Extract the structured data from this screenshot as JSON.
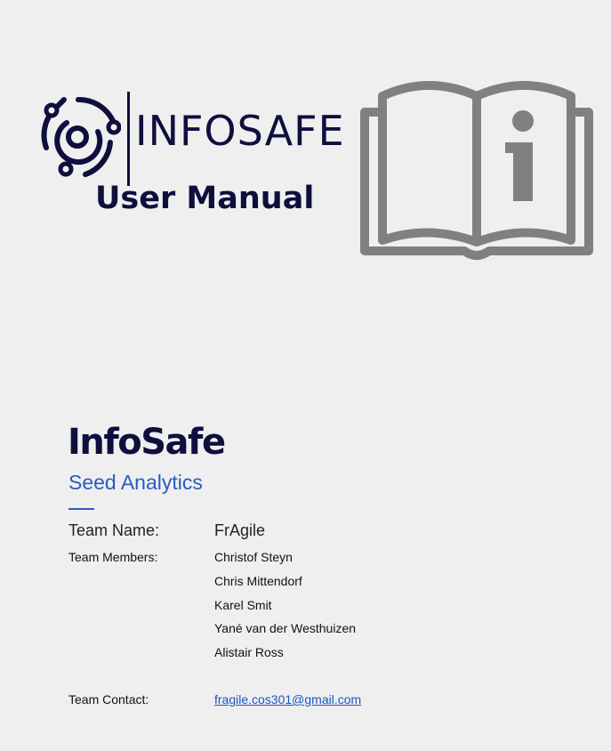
{
  "cover": {
    "brand": "INFOSAFE",
    "subtitle": "User Manual",
    "project_title": "InfoSafe",
    "company": "Seed Analytics"
  },
  "team": {
    "name_label": "Team Name:",
    "name": "FrAgile",
    "members_label": "Team Members:",
    "members": [
      "Christof Steyn",
      "Chris Mittendorf",
      "Karel Smit",
      "Yané van der Westhuizen",
      "Alistair Ross"
    ],
    "contact_label": "Team Contact:",
    "contact_email": "fragile.cos301@gmail.com"
  },
  "icons": {
    "logo": "infosafe-logo-icon",
    "book": "info-book-icon"
  },
  "colors": {
    "navy": "#0f0f3d",
    "accent_blue": "#2a5bbf",
    "icon_gray": "#808080",
    "background": "#efefef"
  }
}
